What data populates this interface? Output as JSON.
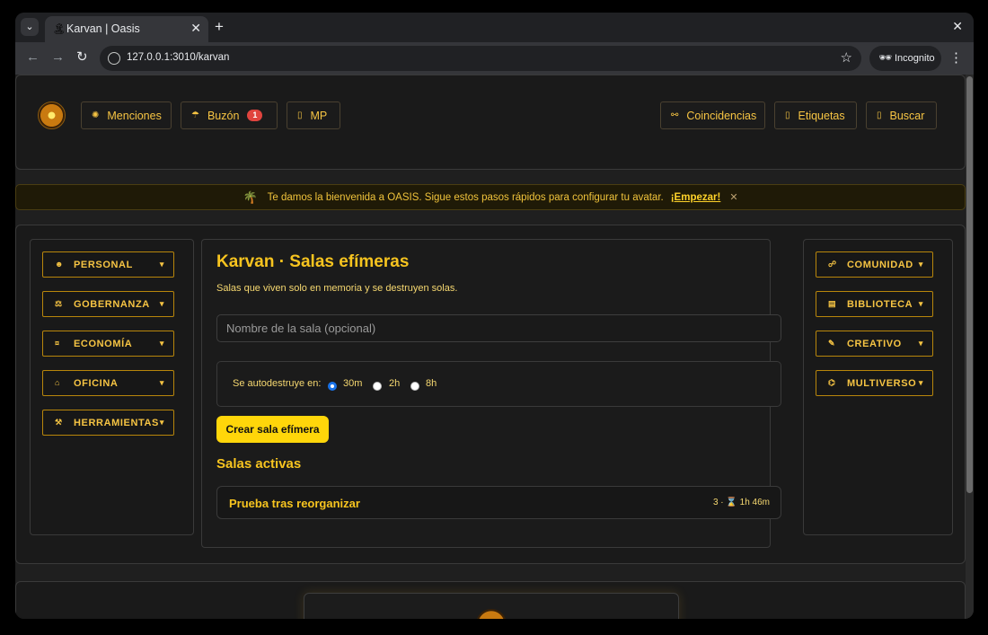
{
  "browser": {
    "tab_title": "Karvan | Oasis",
    "tab_favicon": "🏝",
    "url": "127.0.0.1:3010/karvan",
    "incognito_label": "Incognito",
    "tab_dropdown_icon": "⌄",
    "new_tab_icon": "+",
    "close_icon": "✕",
    "back_icon": "←",
    "forward_icon": "→",
    "reload_icon": "↻",
    "star_icon": "☆",
    "menu_icon": "⋮",
    "incognito_icon": "🕶"
  },
  "header": {
    "left_buttons": [
      {
        "icon": "✺",
        "label": "Menciones"
      },
      {
        "icon": "☂",
        "label": "Buzón",
        "badge": "1"
      },
      {
        "icon": "▯",
        "label": "MP"
      }
    ],
    "right_buttons": [
      {
        "icon": "⚯",
        "label": "Coincidencias"
      },
      {
        "icon": "▯",
        "label": "Etiquetas"
      },
      {
        "icon": "▯",
        "label": "Buscar"
      }
    ]
  },
  "banner": {
    "icon": "🌴",
    "text": "Te damos la bienvenida a OASIS. Sigue estos pasos rápidos para configurar tu avatar.",
    "cta": "¡Empezar!",
    "close": "✕"
  },
  "left_menu": [
    {
      "icon": "☻",
      "label": "PERSONAL"
    },
    {
      "icon": "⚖",
      "label": "GOBERNANZA"
    },
    {
      "icon": "¤",
      "label": "ECONOMÍA"
    },
    {
      "icon": "⌂",
      "label": "OFICINA"
    },
    {
      "icon": "⚒",
      "label": "HERRAMIENTAS"
    }
  ],
  "right_menu": [
    {
      "icon": "☍",
      "label": "COMUNIDAD"
    },
    {
      "icon": "▤",
      "label": "BIBLIOTECA"
    },
    {
      "icon": "✎",
      "label": "CREATIVO"
    },
    {
      "icon": "⌬",
      "label": "MULTIVERSO"
    }
  ],
  "caret": "▾",
  "main": {
    "title": "Karvan · Salas efímeras",
    "subtitle": "Salas que viven solo en memoria y se destruyen solas.",
    "name_placeholder": "Nombre de la sala (opcional)",
    "timer_label": "Se autodestruye en:",
    "timer_options": [
      "30m",
      "2h",
      "8h"
    ],
    "timer_selected": "30m",
    "create_label": "Crear sala efímera",
    "active_title": "Salas activas",
    "rooms": [
      {
        "name": "Prueba tras reorganizar",
        "meta": "3 · ⌛ 1h 46m"
      }
    ]
  }
}
